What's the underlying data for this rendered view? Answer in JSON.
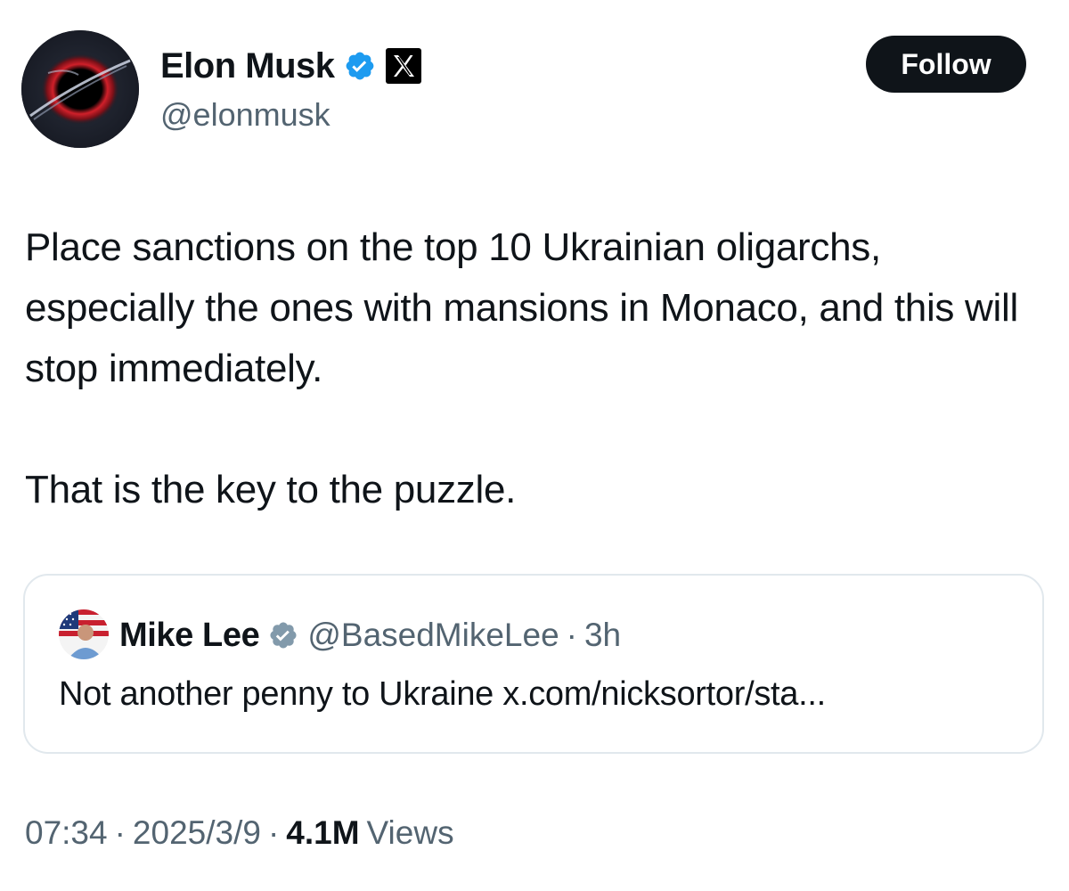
{
  "author": {
    "display_name": "Elon Musk",
    "handle": "@elonmusk",
    "avatar_icon": "black-hole-avatar",
    "verified_icon": "verified-badge-icon",
    "affiliation_icon": "x-logo-icon"
  },
  "follow_button": {
    "label": "Follow"
  },
  "tweet": {
    "paragraph_1": "Place sanctions on the top 10 Ukrainian oligarchs, especially the ones with mansions in Monaco, and this will stop immediately.",
    "paragraph_2": "That is the key to the puzzle."
  },
  "quoted_tweet": {
    "display_name": "Mike Lee",
    "handle": "@BasedMikeLee",
    "separator": "·",
    "time": "3h",
    "text": "Not another penny to Ukraine x.com/nicksortor/sta..."
  },
  "meta": {
    "time": "07:34",
    "separator_1": "·",
    "date": "2025/3/9",
    "separator_2": "·",
    "views_count": "4.1M",
    "views_label": "Views"
  },
  "colors": {
    "text_primary": "#0f1419",
    "text_secondary": "#536471",
    "verified_blue": "#1d9bf0",
    "verified_gray": "#829aab",
    "border": "#e1e8ed"
  }
}
